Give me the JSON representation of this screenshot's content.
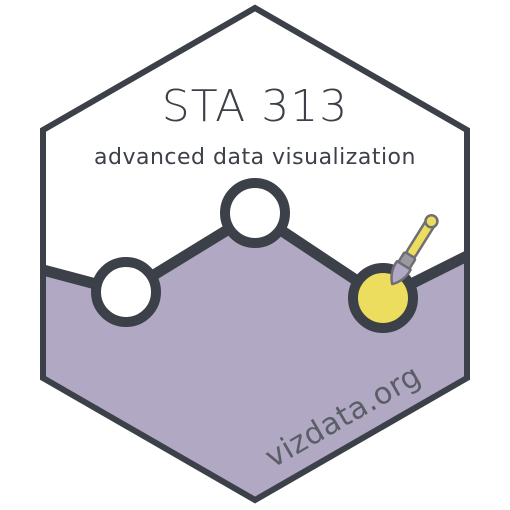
{
  "badge": {
    "title": "STA 313",
    "subtitle": "advanced data visualization",
    "url": "vizdata.org"
  },
  "colors": {
    "outline": "#3c4048",
    "fill_purple": "#b1a8c4",
    "point_open": "#ffffff",
    "point_highlight": "#ecdd5e",
    "text": "#3c4048",
    "url_text": "#5a5e66",
    "paintbrush_handle": "#ecdd5e",
    "paintbrush_ferrule": "#9a9aa0"
  },
  "icons": {
    "paintbrush": "paintbrush-icon"
  }
}
